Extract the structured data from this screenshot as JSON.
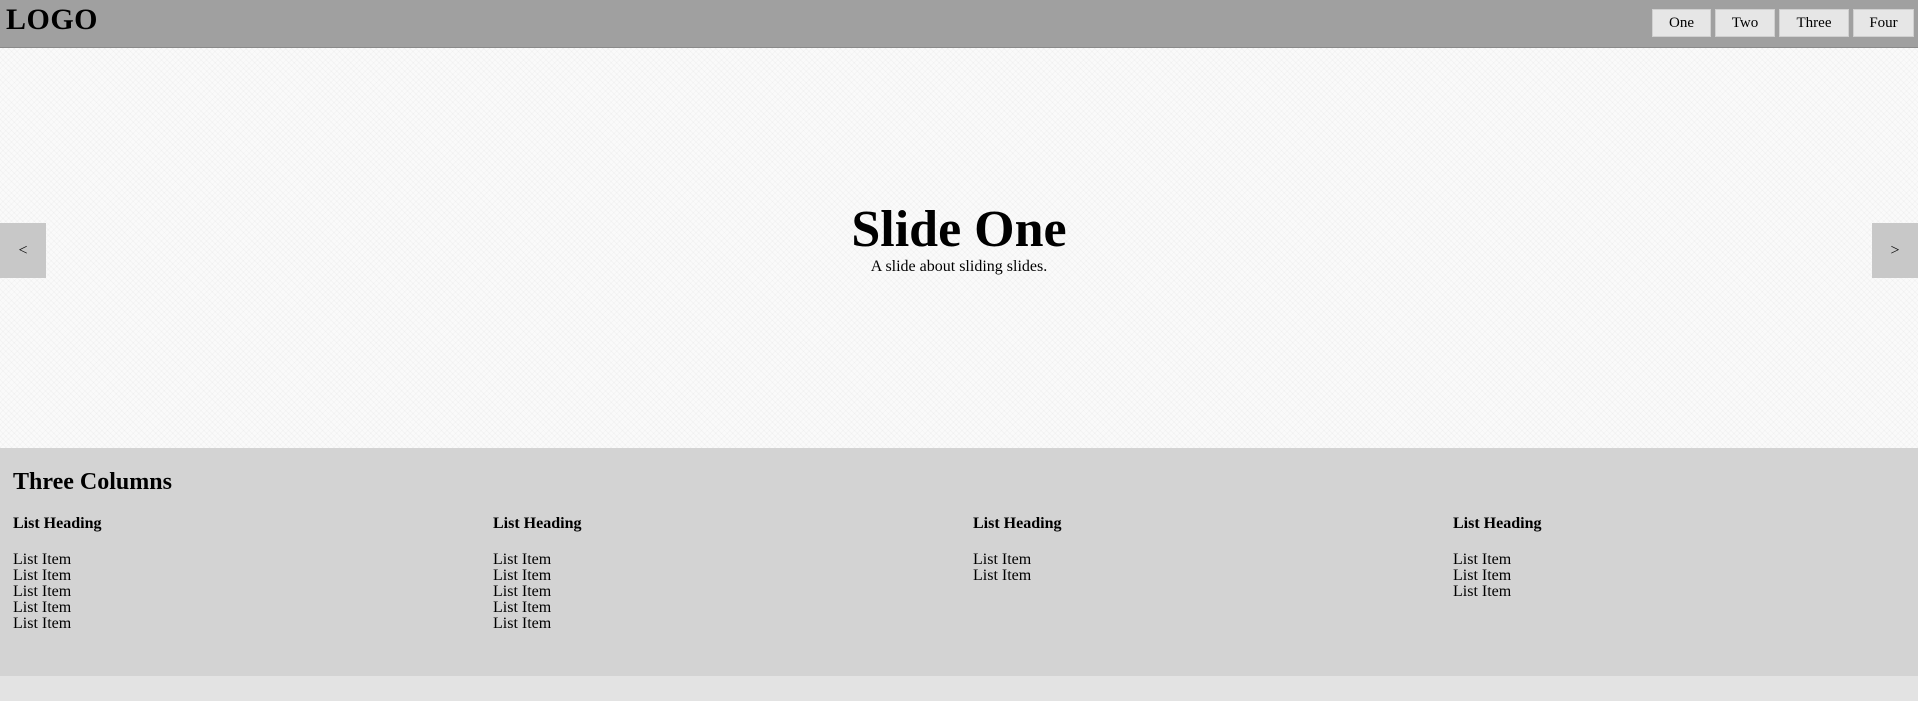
{
  "header": {
    "logo": "LOGO",
    "nav": [
      "One",
      "Two",
      "Three",
      "Four"
    ]
  },
  "hero": {
    "title": "Slide One",
    "subtitle": "A slide about sliding slides.",
    "prev_label": "<",
    "next_label": ">"
  },
  "columns": {
    "title": "Three Columns",
    "items": [
      {
        "heading": "List Heading",
        "list": [
          "List Item",
          "List Item",
          "List Item",
          "List Item",
          "List Item"
        ]
      },
      {
        "heading": "List Heading",
        "list": [
          "List Item",
          "List Item",
          "List Item",
          "List Item",
          "List Item"
        ]
      },
      {
        "heading": "List Heading",
        "list": [
          "List Item",
          "List Item"
        ]
      },
      {
        "heading": "List Heading",
        "list": [
          "List Item",
          "List Item",
          "List Item"
        ]
      }
    ]
  },
  "colors": {
    "header_bg": "#a0a0a0",
    "nav_bg": "#e6e6e6",
    "hero_bg": "#fafafa",
    "arrow_bg": "#c8c8c8",
    "columns_bg": "#d3d3d3",
    "footer_bg": "#e3e3e3"
  }
}
